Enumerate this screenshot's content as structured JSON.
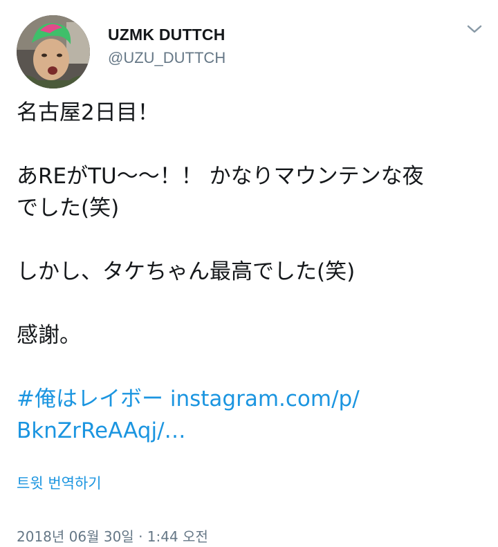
{
  "user": {
    "display_name": "UZMK DUTTCH",
    "handle": "@UZU_DUTTCH",
    "avatar_icon": "profile-photo"
  },
  "menu": {
    "icon": "chevron-down-icon"
  },
  "tweet": {
    "line1": "名古屋2日目！",
    "line2": "あREがTU〜〜！！ かなりマウンテンな夜",
    "line3": "でした(笑)",
    "line4": "しかし、タケちゃん最高でした(笑)",
    "line5": "感謝。",
    "hashtag": "#俺はレイボー",
    "link_part1": "instagram.com/p/",
    "link_part2": "BknZrReAAqj/…"
  },
  "translate_label": "트윗 번역하기",
  "timestamp": "2018년 06월 30일 · 1:44 오전",
  "colors": {
    "link": "#1b95e0",
    "text": "#14171a",
    "secondary": "#657786"
  }
}
